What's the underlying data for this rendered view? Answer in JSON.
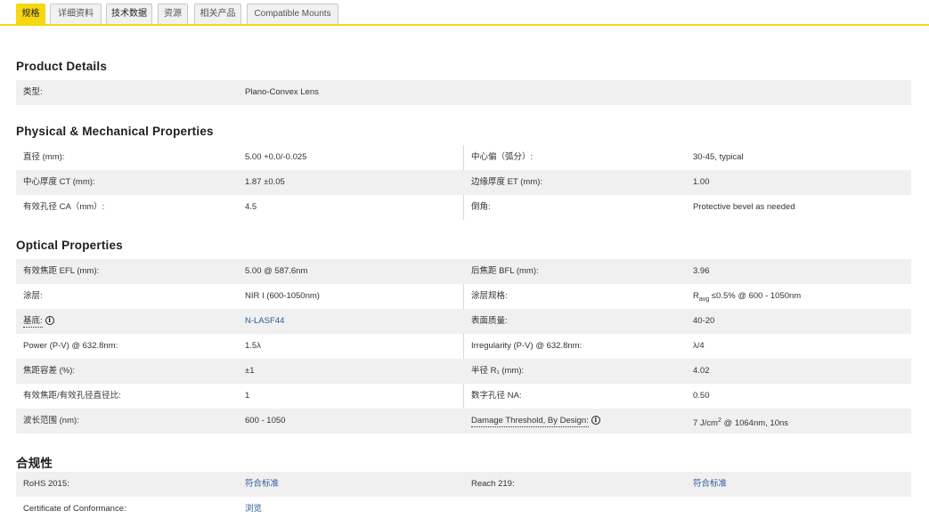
{
  "tabs": [
    {
      "label": "规格"
    },
    {
      "label": "详细资料"
    },
    {
      "label": "技术数据"
    },
    {
      "label": "资源"
    },
    {
      "label": "相关产品"
    },
    {
      "label": "Compatible Mounts"
    }
  ],
  "product_details": {
    "title": "Product Details",
    "type_label": "类型:",
    "type_value": "Plano-Convex Lens"
  },
  "physical": {
    "title": "Physical & Mechanical Properties",
    "rows": [
      {
        "l1": "直径 (mm):",
        "v1": "5.00 +0.0/-0.025",
        "l2": "中心偏（弧分）:",
        "v2": "30-45, typical"
      },
      {
        "l1": "中心厚度 CT (mm):",
        "v1": "1.87 ±0.05",
        "l2": "边缘厚度 ET (mm):",
        "v2": "1.00"
      },
      {
        "l1": "有效孔径 CA（mm）:",
        "v1": "4.5",
        "l2": "倒角:",
        "v2": "Protective bevel as needed"
      }
    ]
  },
  "optical": {
    "title": "Optical Properties",
    "rows": [
      {
        "l1": "有效焦距 EFL (mm):",
        "v1": "5.00 @ 587.6nm",
        "l2": "后焦距 BFL (mm):",
        "v2": "3.96"
      },
      {
        "l1": "涂层:",
        "v1": "NIR I (600-1050nm)",
        "l2": "涂层规格:",
        "v2_r": "R",
        "v2_sub": "avg",
        "v2_rest": " ≤0.5% @ 600 - 1050nm"
      },
      {
        "l1": "基底:",
        "v1": "N-LASF44",
        "l2": "表面质量:",
        "v2": "40-20"
      },
      {
        "l1": "Power (P-V) @ 632.8nm:",
        "v1": "1.5λ",
        "l2": "Irregularity (P-V) @ 632.8nm:",
        "v2": "λ/4"
      },
      {
        "l1": "焦距容差 (%):",
        "v1": "±1",
        "l2": "半径 R₁ (mm):",
        "v2": "4.02"
      },
      {
        "l1": "有效焦距/有效孔径直径比:",
        "v1": "1",
        "l2": "数字孔径 NA:",
        "v2": "0.50"
      },
      {
        "l1": "波长范围 (nm):",
        "v1": "600 - 1050",
        "l2": "Damage Threshold, By Design:",
        "v2_a": "7 J/cm",
        "v2_sup": "2",
        "v2_b": " @ 1064nm, 10ns"
      }
    ]
  },
  "compliance": {
    "title": "合规性",
    "rows": [
      {
        "l1": "RoHS 2015:",
        "v1": "符合标准",
        "l2": "Reach 219:",
        "v2": "符合标准"
      },
      {
        "l1": "Certificate of Conformance:",
        "v1": "浏览"
      }
    ]
  },
  "info_icon_glyph": "i",
  "colors": {
    "accent": "#f5d712",
    "row_shade": "#f0f0f0",
    "link": "#2a5c9a"
  }
}
